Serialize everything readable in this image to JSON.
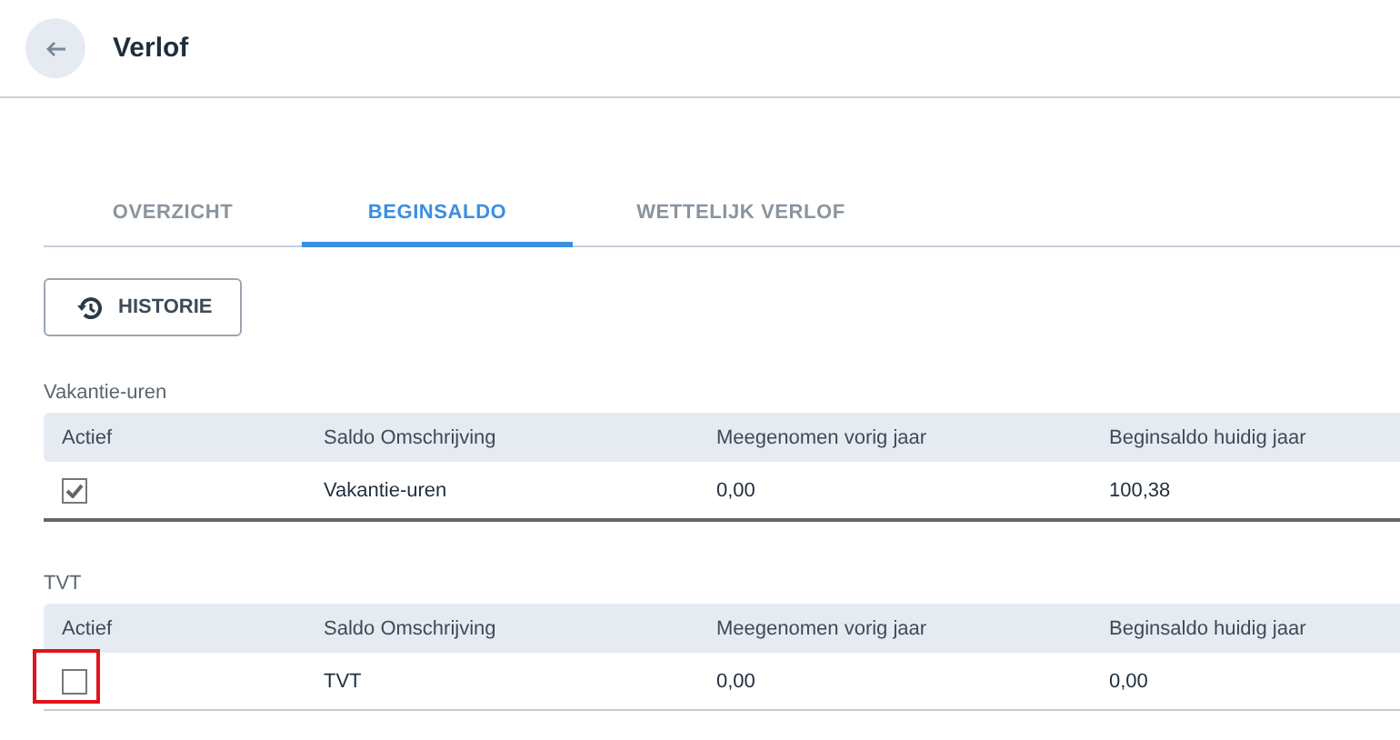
{
  "header": {
    "title": "Verlof"
  },
  "tabs": [
    {
      "label": "OVERZICHT",
      "selected": false
    },
    {
      "label": "BEGINSALDO",
      "selected": true
    },
    {
      "label": "WETTELIJK VERLOF",
      "selected": false
    }
  ],
  "history_button": "HISTORIE",
  "sections": [
    {
      "title": "Vakantie-uren",
      "columns": [
        "Actief",
        "Saldo Omschrijving",
        "Meegenomen vorig jaar",
        "Beginsaldo huidig jaar"
      ],
      "rows": [
        {
          "checked": true,
          "highlighted": false,
          "cells": [
            "",
            "Vakantie-uren",
            "0,00",
            "100,38"
          ]
        }
      ]
    },
    {
      "title": "TVT",
      "columns": [
        "Actief",
        "Saldo Omschrijving",
        "Meegenomen vorig jaar",
        "Beginsaldo huidig jaar"
      ],
      "rows": [
        {
          "checked": false,
          "highlighted": true,
          "cells": [
            "",
            "TVT",
            "0,00",
            "0,00"
          ]
        }
      ]
    }
  ]
}
